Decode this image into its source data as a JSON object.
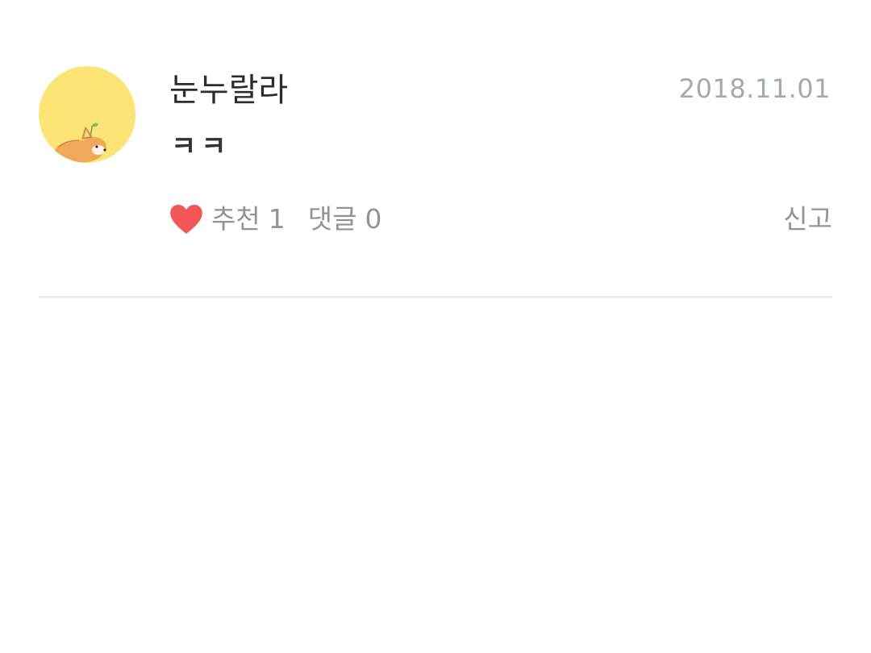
{
  "comment": {
    "author": "눈누랄라",
    "date": "2018.11.01",
    "text": "ㅋㅋ",
    "avatar_icon": "corgi-avatar",
    "like_icon": "heart-icon",
    "like_label": "추천",
    "like_count": "1",
    "reply_label": "댓글",
    "reply_count": "0",
    "report_label": "신고"
  },
  "colors": {
    "avatar_bg": "#fde476",
    "heart": "#f25656",
    "muted_text": "#8f949b",
    "date_text": "#a4a9b0",
    "divider": "#ececec"
  }
}
